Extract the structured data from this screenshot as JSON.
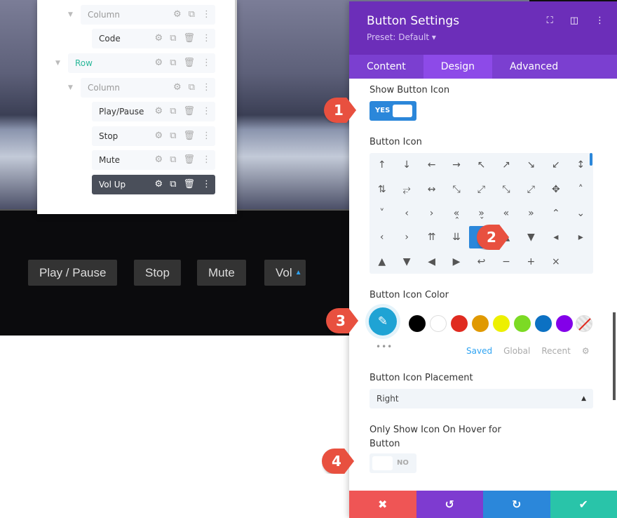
{
  "video_buttons": [
    {
      "label": "Play / Pause"
    },
    {
      "label": "Stop"
    },
    {
      "label": "Mute"
    },
    {
      "label": "Vol",
      "icon": "caret-up-icon"
    }
  ],
  "layers": [
    {
      "label": "Column",
      "type": "column"
    },
    {
      "label": "Code",
      "type": "module"
    },
    {
      "label": "Row",
      "type": "row"
    },
    {
      "label": "Column",
      "type": "column"
    },
    {
      "label": "Play/Pause",
      "type": "module"
    },
    {
      "label": "Stop",
      "type": "module"
    },
    {
      "label": "Mute",
      "type": "module"
    },
    {
      "label": "Vol Up",
      "type": "module",
      "selected": true
    }
  ],
  "panel": {
    "title": "Button Settings",
    "preset": "Preset: Default ▾",
    "tabs": [
      "Content",
      "Design",
      "Advanced"
    ],
    "active_tab": "Design",
    "show_icon_label": "Show Button Icon",
    "show_icon_value": "YES",
    "icon_label": "Button Icon",
    "icons": [
      "↑",
      "↓",
      "←",
      "→",
      "↖",
      "↗",
      "↘",
      "↙",
      "↕",
      "⇅",
      "⥂",
      "↔",
      "⤡",
      "⤢",
      "⤡",
      "⤢",
      "✥",
      "˄",
      "˅",
      "‹",
      "›",
      "«̭",
      "»̬",
      "«",
      "»",
      "⌃",
      "⌄",
      "‹",
      "›",
      "⇈",
      "⇊",
      "⊙",
      "▲",
      "▼",
      "◂",
      "▸",
      "▲",
      "▼",
      "◀",
      "▶",
      "↩",
      "−",
      "+",
      "×"
    ],
    "selected_icon": "▲",
    "color_label": "Button Icon Color",
    "swatches": [
      "#000000",
      "#ffffff",
      "#e02b20",
      "#e09900",
      "#edf000",
      "#7cda24",
      "#0c71c3",
      "#8300e9"
    ],
    "picker_color": "#1fa3d4",
    "color_tabs": [
      "Saved",
      "Global",
      "Recent"
    ],
    "placement_label": "Button Icon Placement",
    "placement_value": "Right",
    "hover_label": "Only Show Icon On Hover for Button",
    "hover_value": "NO",
    "footer_colors": {
      "cancel": "#ef5555",
      "undo": "#7e3bd0",
      "redo": "#2b87da",
      "save": "#29c4a9"
    }
  },
  "markers": [
    "1",
    "2",
    "3",
    "4"
  ]
}
